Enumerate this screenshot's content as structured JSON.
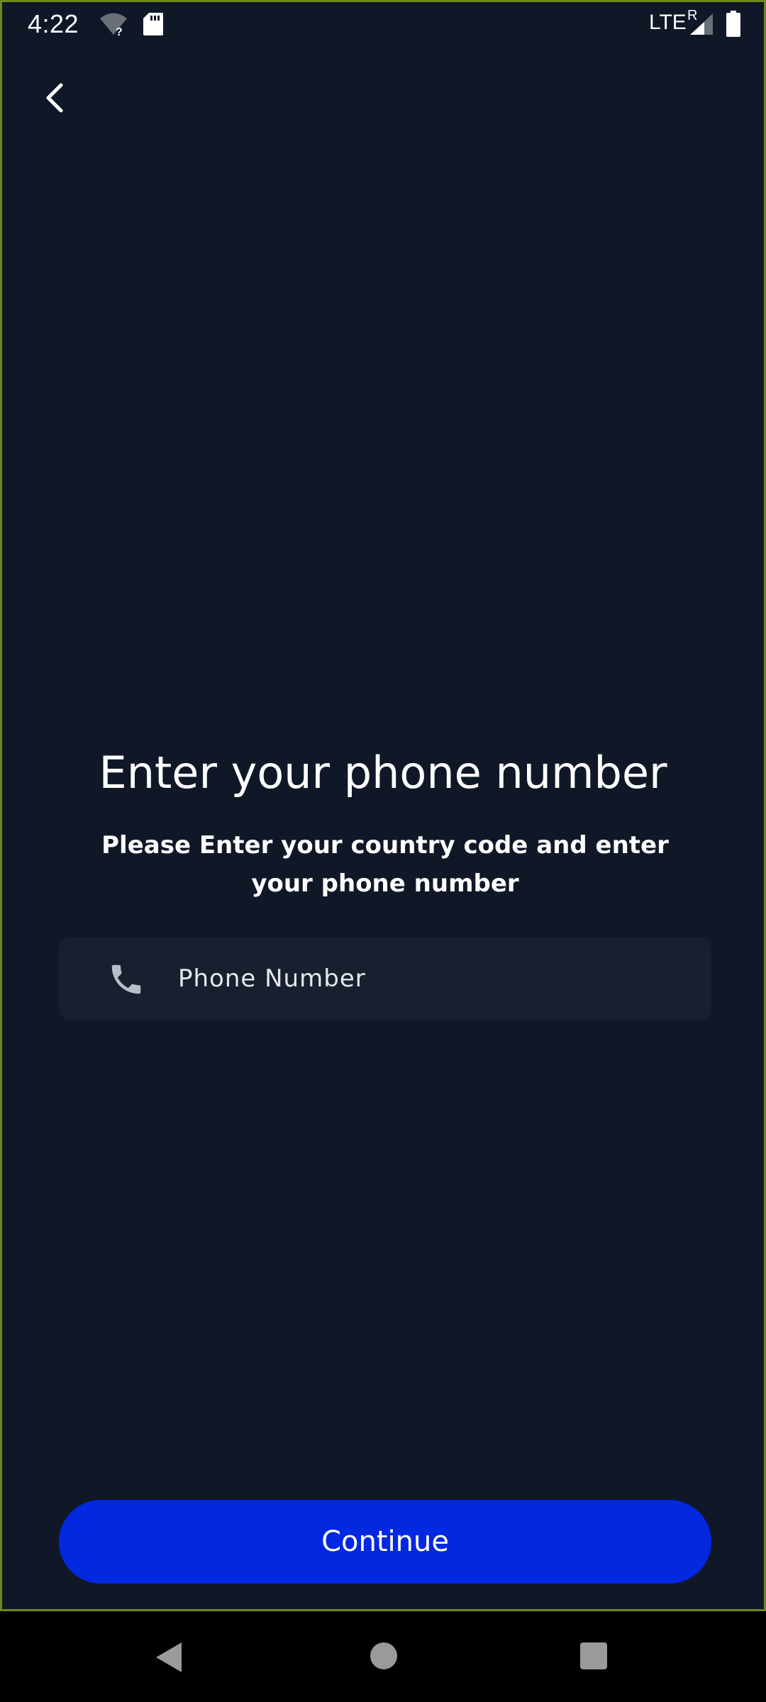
{
  "status_bar": {
    "time": "4:22",
    "network": "LTE",
    "roaming_indicator": "R",
    "icons": [
      "wifi-unknown-icon",
      "sd-card-icon",
      "signal-icon",
      "battery-icon"
    ]
  },
  "header": {
    "back_icon": "chevron-left-icon"
  },
  "main": {
    "title": "Enter your phone number",
    "subtitle": "Please Enter your country code and enter your phone number",
    "phone_field": {
      "icon": "phone-icon",
      "placeholder": "Phone Number",
      "value": ""
    },
    "continue_label": "Continue"
  },
  "nav_bar": {
    "icons": [
      "nav-back-icon",
      "nav-home-icon",
      "nav-recents-icon"
    ]
  },
  "colors": {
    "background": "#101828",
    "field_background": "#18202f",
    "primary_button": "#0228e0",
    "text": "#ffffff"
  }
}
